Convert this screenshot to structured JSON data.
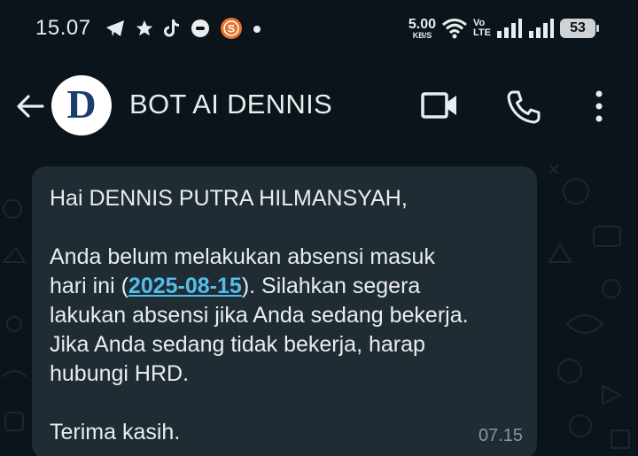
{
  "status_bar": {
    "time": "15.07",
    "net_speed_value": "5.00",
    "net_speed_unit": "KB/S",
    "volte_top": "Vo",
    "volte_bottom": "LTE",
    "battery": "53",
    "icons": [
      "telegram-icon",
      "star-icon",
      "tiktok-icon",
      "message-icon",
      "app-s-icon",
      "dot-icon",
      "wifi-icon",
      "signal-icon",
      "signal-icon-2",
      "battery-icon"
    ]
  },
  "header": {
    "contact_name": "BOT AI DENNIS",
    "avatar_letter": "D"
  },
  "message": {
    "greeting": "Hai DENNIS PUTRA HILMANSYAH,",
    "line1": "Anda belum melakukan absensi masuk",
    "line2_before": "hari ini (",
    "date": "2025-08-15",
    "line2_after": "). Silahkan segera",
    "line3": "lakukan absensi jika Anda sedang bekerja.",
    "line4": "Jika Anda sedang tidak bekerja, harap",
    "line5": "hubungi HRD.",
    "closing": "Terima kasih.",
    "time": "07.15"
  },
  "colors": {
    "background": "#0b141a",
    "bubble": "#202c33",
    "text": "#e9edef",
    "link": "#53bdeb",
    "meta": "#8696a0"
  }
}
